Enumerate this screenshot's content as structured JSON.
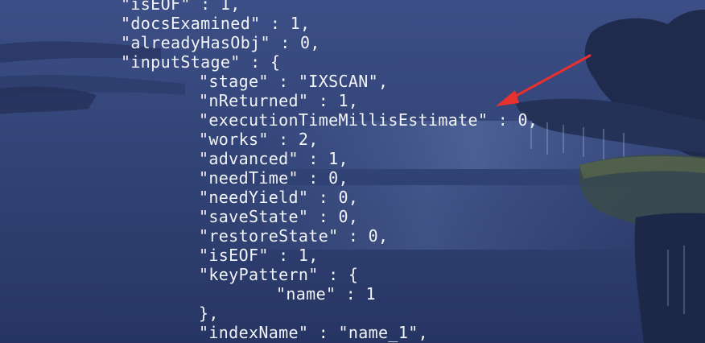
{
  "terminal": {
    "lines": [
      {
        "text": "\"isEOF\" : 1,"
      },
      {
        "text": "\"docsExamined\" : 1,"
      },
      {
        "text": "\"alreadyHasObj\" : 0,"
      },
      {
        "text": "\"inputStage\" : {"
      },
      {
        "text": "\"stage\" : \"IXSCAN\","
      },
      {
        "text": "\"nReturned\" : 1,"
      },
      {
        "text": "\"executionTimeMillisEstimate\" : 0,"
      },
      {
        "text": "\"works\" : 2,"
      },
      {
        "text": "\"advanced\" : 1,"
      },
      {
        "text": "\"needTime\" : 0,"
      },
      {
        "text": "\"needYield\" : 0,"
      },
      {
        "text": "\"saveState\" : 0,"
      },
      {
        "text": "\"restoreState\" : 0,"
      },
      {
        "text": "\"isEOF\" : 1,"
      },
      {
        "text": "\"keyPattern\" : {"
      },
      {
        "text": "\"name\" : 1"
      },
      {
        "text": "},"
      },
      {
        "text": "\"indexName\" : \"name_1\","
      }
    ]
  },
  "annotation": {
    "arrow_color": "#e8302e",
    "arrow_target": "executionTimeMillisEstimate value"
  },
  "colors": {
    "text": "#f2f3f6",
    "background": "#2f3d6c"
  }
}
